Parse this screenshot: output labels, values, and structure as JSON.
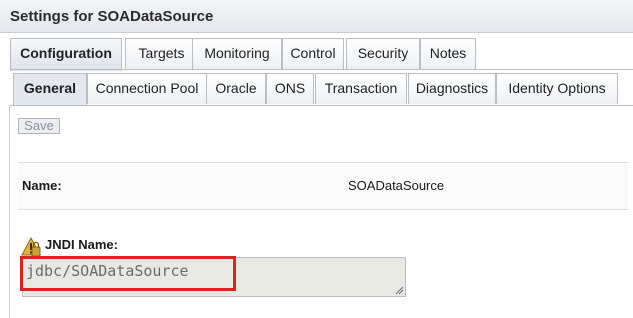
{
  "header": {
    "title": "Settings for SOADataSource"
  },
  "tabs_primary": [
    {
      "label": "Configuration",
      "active": true
    },
    {
      "label": "Targets"
    },
    {
      "label": "Monitoring"
    },
    {
      "label": "Control"
    },
    {
      "label": "Security"
    },
    {
      "label": "Notes"
    }
  ],
  "tabs_secondary": [
    {
      "label": "General",
      "active": true
    },
    {
      "label": "Connection Pool"
    },
    {
      "label": "Oracle"
    },
    {
      "label": "ONS"
    },
    {
      "label": "Transaction"
    },
    {
      "label": "Diagnostics"
    },
    {
      "label": "Identity Options"
    }
  ],
  "toolbar": {
    "save_label": "Save"
  },
  "form": {
    "name_label": "Name:",
    "name_value": "SOADataSource",
    "jndi_label": "JNDI Name:",
    "jndi_value": "jdbc/SOADataSource"
  },
  "colors": {
    "highlight": "#e02020",
    "warning_icon": "#e6b23a"
  }
}
